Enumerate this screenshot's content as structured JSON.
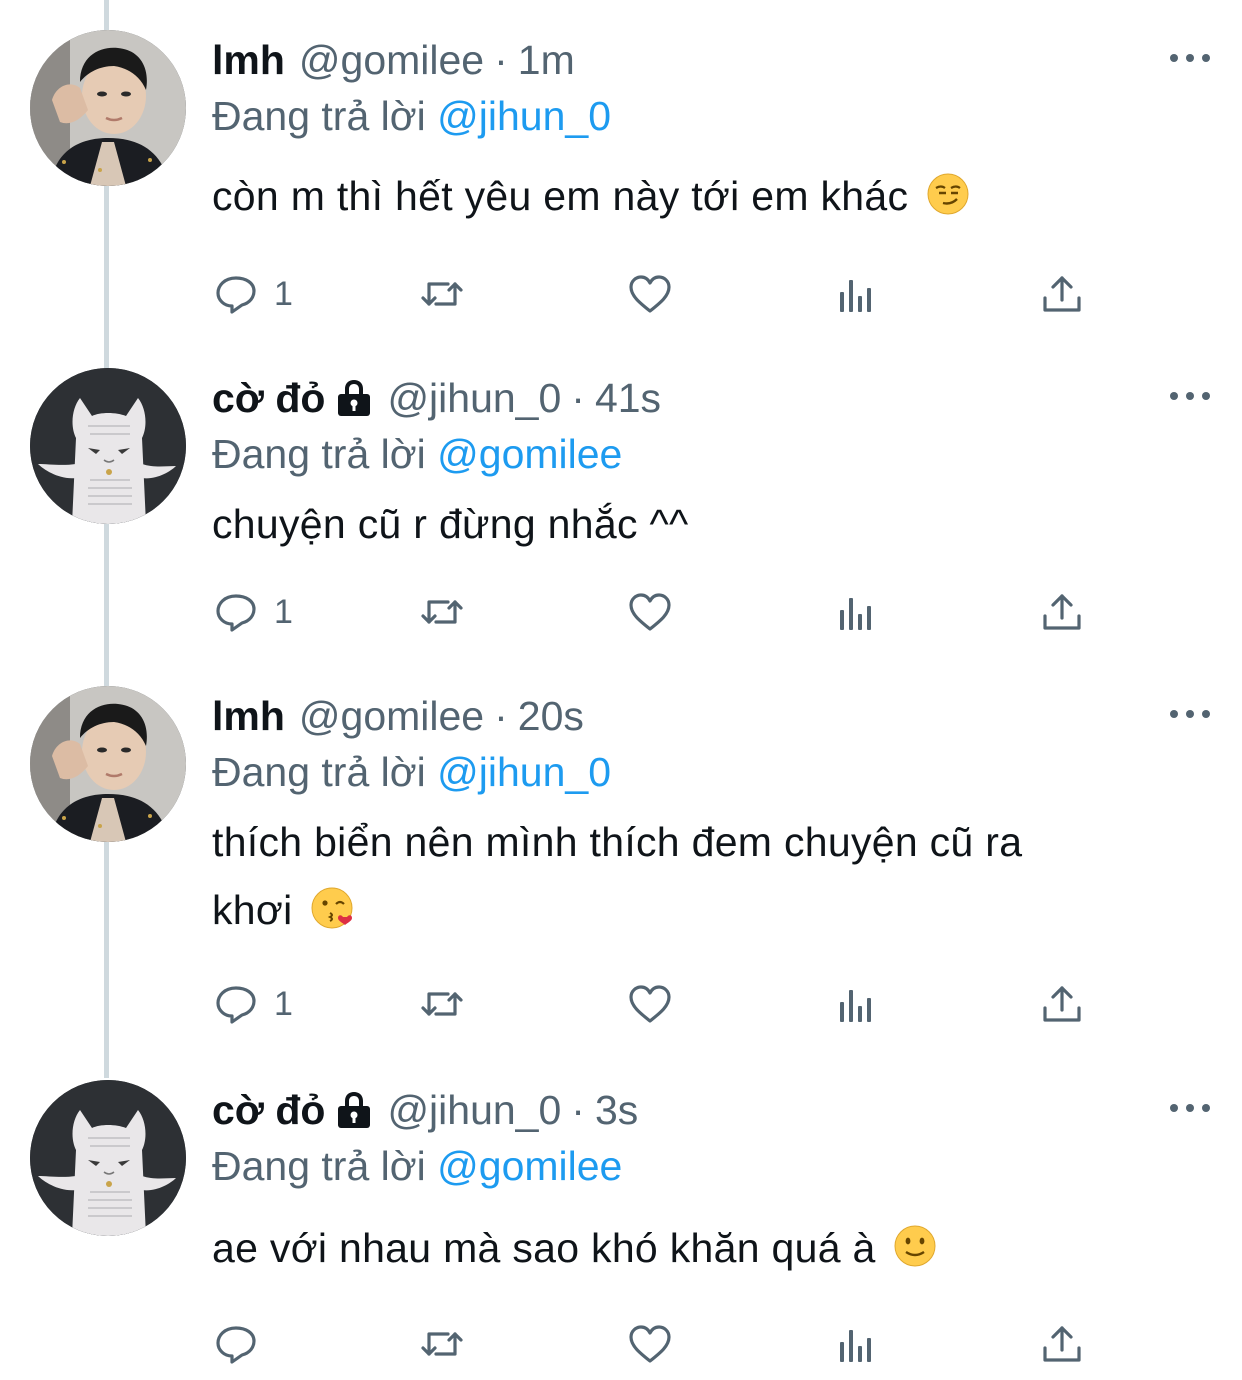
{
  "tweets": [
    {
      "display_name": "lmh",
      "locked": false,
      "handle": "@gomilee",
      "separator": "·",
      "time": "1m",
      "reply_prefix": "Đang trả lời",
      "reply_to": "@jihun_0",
      "text": "còn m thì hết yêu em này tới em khác",
      "emoji": "smirk-emoji",
      "reply_count": "1"
    },
    {
      "display_name": "cờ đỏ",
      "locked": true,
      "handle": "@jihun_0",
      "separator": "·",
      "time": "41s",
      "reply_prefix": "Đang trả lời",
      "reply_to": "@gomilee",
      "text": "chuyện cũ r đừng nhắc ^^",
      "emoji": "",
      "reply_count": "1"
    },
    {
      "display_name": "lmh",
      "locked": false,
      "handle": "@gomilee",
      "separator": "·",
      "time": "20s",
      "reply_prefix": "Đang trả lời",
      "reply_to": "@jihun_0",
      "text_line1": "thích biển nên mình thích đem chuyện cũ ra",
      "text_line2": "khơi",
      "emoji": "kissing-heart-emoji",
      "reply_count": "1"
    },
    {
      "display_name": "cờ đỏ",
      "locked": true,
      "handle": "@jihun_0",
      "separator": "·",
      "time": "3s",
      "reply_prefix": "Đang trả lời",
      "reply_to": "@gomilee",
      "text": "ae với nhau mà sao khó khăn quá à",
      "emoji": "slight-smile-emoji",
      "reply_count": ""
    }
  ],
  "colors": {
    "text": "#0f1419",
    "secondary": "#536471",
    "link": "#1d9bf0",
    "thread_line": "#cfd9de"
  },
  "icons": {
    "reply": "reply-icon",
    "retweet": "retweet-icon",
    "like": "heart-icon",
    "views": "analytics-icon",
    "share": "share-icon",
    "more": "more-icon",
    "lock": "lock-icon"
  }
}
